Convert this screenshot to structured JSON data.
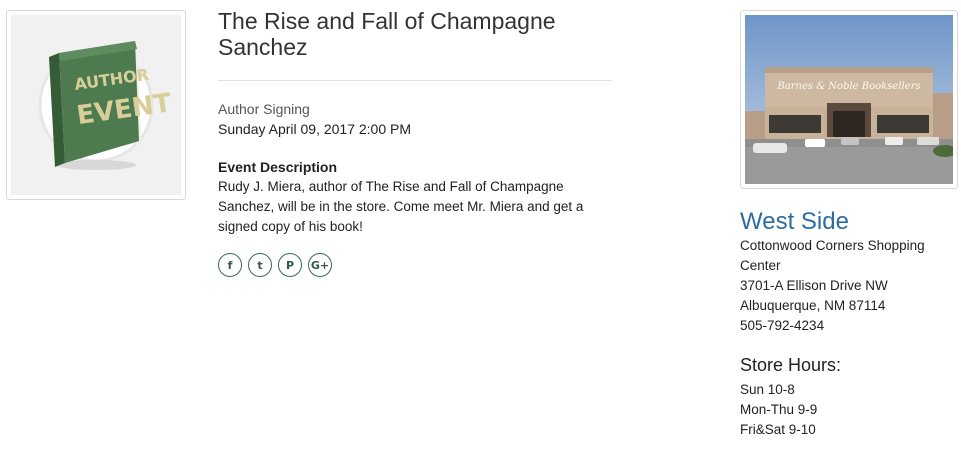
{
  "event": {
    "thumbnail_text_line1": "AUTHOR",
    "thumbnail_text_line2": "EVENT",
    "title": "The Rise and Fall of Champagne Sanchez",
    "type": "Author Signing",
    "datetime": "Sunday April 09, 2017 2:00 PM",
    "description_heading": "Event Description",
    "description": "Rudy J. Miera, author of The Rise and Fall of Champagne Sanchez, will be in the store. Come meet Mr. Miera and get a signed copy of his book!"
  },
  "social": [
    {
      "name": "facebook-icon",
      "glyph": "f"
    },
    {
      "name": "twitter-icon",
      "glyph": "t"
    },
    {
      "name": "pinterest-icon",
      "glyph": "P"
    },
    {
      "name": "google-plus-icon",
      "glyph": "G+"
    }
  ],
  "store": {
    "photo_sign": "Barnes & Noble Booksellers",
    "name": "West Side",
    "address_line1": "Cottonwood Corners Shopping Center",
    "address_line2": "3701-A Ellison Drive NW",
    "address_line3": "Albuquerque, NM 87114",
    "phone": "505-792-4234",
    "hours_title": "Store Hours:",
    "hours": [
      "Sun 10-8",
      "Mon-Thu 9-9",
      "Fri&Sat 9-10"
    ]
  },
  "colors": {
    "book_green": "#4e7a4f",
    "store_link": "#2d6ca2",
    "social_green": "#2f5c3f"
  }
}
